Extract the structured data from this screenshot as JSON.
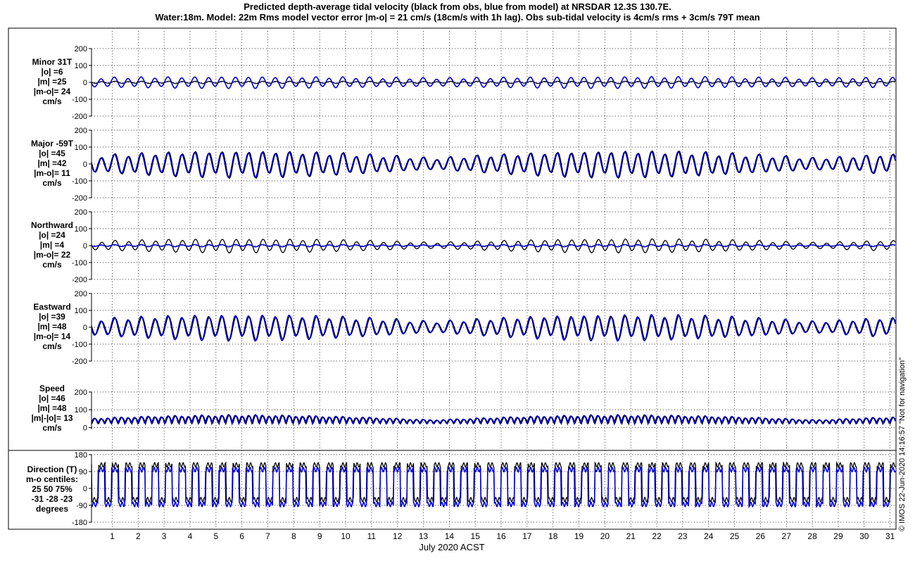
{
  "title": {
    "line1": "Predicted depth-average tidal velocity (black from obs, blue from model) at NRSDAR 12.3S 130.7E.",
    "line2": "Water:18m. Model: 22m  Rms model vector error |m-o| = 21 cm/s (18cm/s with 1h lag). Obs sub-tidal velocity is 4cm/s rms + 3cm/s 79T mean"
  },
  "credit": "© IMOS 22-Jun-2020 14:16:57  \"Not for navigation\"",
  "colors": {
    "obs": "#000000",
    "model": "#0000cc",
    "grid": "#000000",
    "frame": "#000000"
  },
  "chart_data": [
    {
      "type": "line",
      "id": "minor",
      "label_lines": [
        "Minor 31T",
        "|o| =6",
        "|m| =25",
        "|m-o|= 24",
        "cm/s"
      ],
      "yticks": [
        "200",
        "100",
        "0",
        "-100",
        "-200"
      ],
      "ylim": [
        -200,
        200
      ],
      "xlim": [
        0.2,
        31.2
      ],
      "grid": true,
      "series": [
        {
          "role": "obs",
          "amplitude_cm_s": 6,
          "offset": 0,
          "modulation": 0.2
        },
        {
          "role": "model",
          "amplitude_cm_s": 30,
          "offset": 0,
          "modulation": 0.25
        }
      ]
    },
    {
      "type": "line",
      "id": "major",
      "label_lines": [
        "Major -59T",
        "|o| =45",
        "|m| =42",
        "|m-o|= 11",
        "cm/s"
      ],
      "yticks": [
        "200",
        "100",
        "0",
        "-100",
        "-200"
      ],
      "ylim": [
        -200,
        200
      ],
      "xlim": [
        0.2,
        31.2
      ],
      "grid": true,
      "series": [
        {
          "role": "obs",
          "amplitude_cm_s": 70,
          "offset": 0,
          "modulation": 0.55
        },
        {
          "role": "model",
          "amplitude_cm_s": 66,
          "offset": 0,
          "modulation": 0.55
        }
      ]
    },
    {
      "type": "line",
      "id": "northward",
      "label_lines": [
        "Northward",
        "|o| =24",
        "|m| =4",
        "|m-o|= 22",
        "cm/s"
      ],
      "yticks": [
        "200",
        "100",
        "0",
        "-100",
        "-200"
      ],
      "ylim": [
        -200,
        200
      ],
      "xlim": [
        0.2,
        31.2
      ],
      "grid": true,
      "series": [
        {
          "role": "obs",
          "amplitude_cm_s": 36,
          "offset": 0,
          "modulation": 0.55
        },
        {
          "role": "model",
          "amplitude_cm_s": 6,
          "offset": 0,
          "modulation": 0.4
        }
      ]
    },
    {
      "type": "line",
      "id": "eastward",
      "label_lines": [
        "Eastward",
        "|o| =39",
        "|m| =48",
        "|m-o|= 14",
        "cm/s"
      ],
      "yticks": [
        "200",
        "100",
        "0",
        "-100",
        "-200"
      ],
      "ylim": [
        -200,
        200
      ],
      "xlim": [
        0.2,
        31.2
      ],
      "grid": true,
      "series": [
        {
          "role": "obs",
          "amplitude_cm_s": 62,
          "offset": 0,
          "modulation": 0.55
        },
        {
          "role": "model",
          "amplitude_cm_s": 68,
          "offset": 0,
          "modulation": 0.55
        }
      ]
    },
    {
      "type": "line",
      "id": "speed",
      "label_lines": [
        "Speed",
        "|o| =46",
        "|m| =48",
        "|m|-|o|= 13",
        "cm/s"
      ],
      "yticks": [
        "200",
        "100",
        "0"
      ],
      "ylim": [
        -10,
        200
      ],
      "xlim": [
        0.2,
        31.2
      ],
      "grid": true,
      "series": [
        {
          "role": "obs",
          "amplitude_cm_s": 45,
          "offset": 45,
          "modulation": 0.55
        },
        {
          "role": "model",
          "amplitude_cm_s": 47,
          "offset": 47,
          "modulation": 0.55
        }
      ]
    },
    {
      "type": "line",
      "id": "direction",
      "label_lines": [
        "Direction (T)",
        "m-o centiles:",
        "25  50  75%",
        "-31  -28  -23",
        "degrees"
      ],
      "yticks": [
        "180",
        "90",
        "0",
        "-90",
        "-180"
      ],
      "ylim": [
        -180,
        180
      ],
      "xlim": [
        0.2,
        31.2
      ],
      "grid": true,
      "series": [
        {
          "role": "obs",
          "high_deg": 125,
          "low_deg": -60
        },
        {
          "role": "model",
          "high_deg": 100,
          "low_deg": -85
        }
      ]
    }
  ],
  "x_axis": {
    "label": "July 2020 ACST",
    "ticks": [
      "1",
      "2",
      "3",
      "4",
      "5",
      "6",
      "7",
      "8",
      "9",
      "10",
      "11",
      "12",
      "13",
      "14",
      "15",
      "16",
      "17",
      "18",
      "19",
      "20",
      "21",
      "22",
      "23",
      "24",
      "25",
      "26",
      "27",
      "28",
      "29",
      "30",
      "31"
    ]
  }
}
